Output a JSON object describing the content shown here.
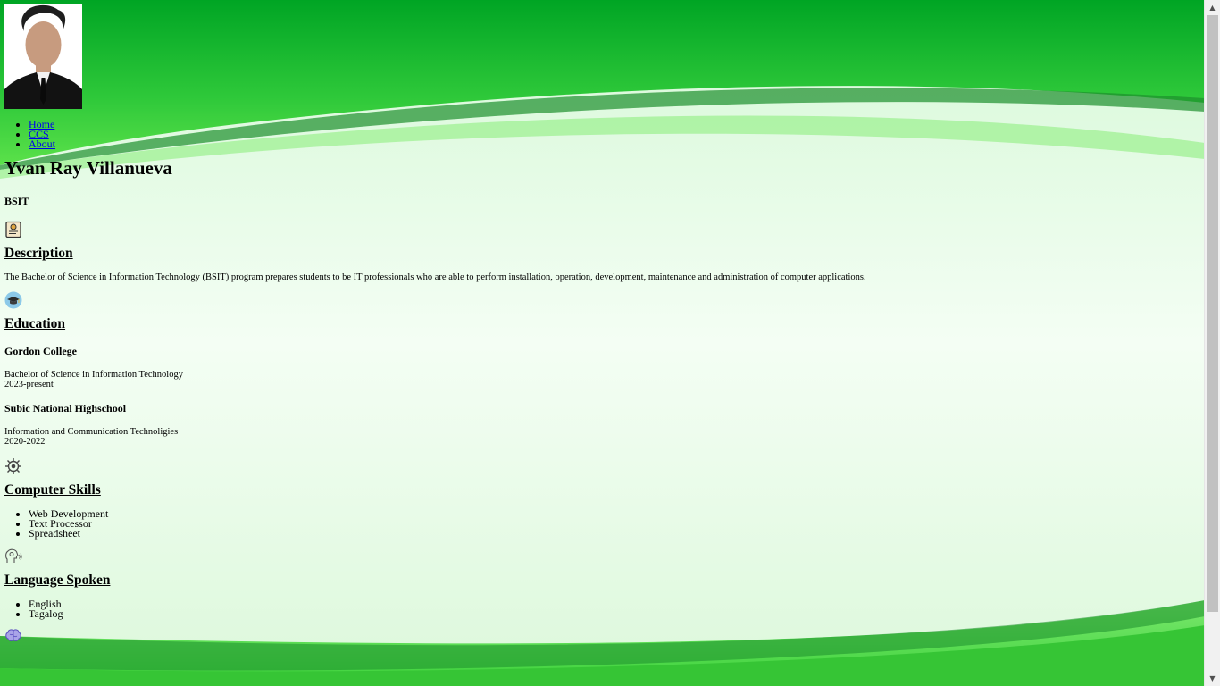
{
  "nav": {
    "items": [
      {
        "label": "Home"
      },
      {
        "label": "CCS"
      },
      {
        "label": "About"
      }
    ]
  },
  "profile": {
    "name": "Yvan Ray Villanueva",
    "role": "BSIT"
  },
  "description": {
    "heading": "Description",
    "text": "The Bachelor of Science in Information Technology (BSIT) program prepares students to be IT professionals who are able to perform installation, operation, development, maintenance and administration of computer applications."
  },
  "education": {
    "heading": "Education",
    "schools": [
      {
        "name": "Gordon College",
        "program": "Bachelor of Science in Information Technology",
        "years": "2023-present"
      },
      {
        "name": "Subic National Highschool",
        "program": "Information and Communication Technoligies",
        "years": "2020-2022"
      }
    ]
  },
  "skills": {
    "heading": "Computer Skills",
    "items": [
      "Web Development",
      "Text Processor",
      "Spreadsheet"
    ]
  },
  "languages": {
    "heading": "Language Spoken",
    "items": [
      "English",
      "Tagalog"
    ]
  },
  "icons": {
    "certificate": "certificate-icon",
    "education": "graduation-cap-icon",
    "skills": "gear-icon",
    "languages": "speaking-head-icon",
    "extra": "brain-icon"
  },
  "colors": {
    "green_dark": "#00a524",
    "green_light": "#5be14a",
    "bg_light": "#e8fbe9"
  }
}
